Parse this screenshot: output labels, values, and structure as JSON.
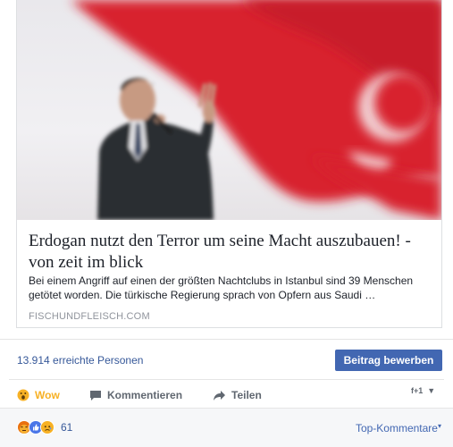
{
  "link_card": {
    "title": "Erdogan nutzt den Terror um seine Macht auszubauen! - von zeit im blick",
    "description": "Bei einem Angriff auf einen der größten Nachtclubs in Istanbul sind 39 Menschen getötet worden. Die türkische Regierung sprach von Opfern aus Saudi …",
    "domain": "FISCHUNDFLEISCH.COM"
  },
  "insights": {
    "reach_text": "13.914 erreichte Personen",
    "boost_label": "Beitrag bewerben"
  },
  "actions": {
    "reaction_label": "Wow",
    "comment_label": "Kommentieren",
    "share_label": "Teilen",
    "audience_icon": "f+1"
  },
  "footer": {
    "reaction_count": "61",
    "sort_label": "Top-Kommentare"
  },
  "colors": {
    "link_blue": "#365899",
    "button_blue": "#4267b2",
    "wow_yellow": "#f7b125",
    "flag_red": "#d8232f"
  }
}
